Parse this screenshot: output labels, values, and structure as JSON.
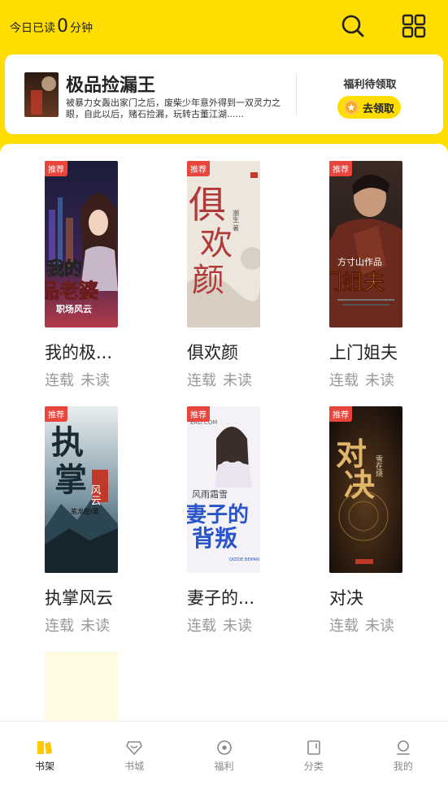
{
  "header": {
    "read_prefix": "今日已读",
    "read_minutes": "0",
    "read_suffix": "分钟"
  },
  "promo": {
    "title": "极品捡漏王",
    "description": "被暴力女轰出家门之后，废柴少年意外得到一双灵力之眼，自此以后，赌石捡漏，玩转古董江湖......",
    "reward_label": "福利待领取",
    "claim_button": "去领取"
  },
  "books": [
    {
      "title": "我的极...",
      "status": "连载",
      "read_state": "未读",
      "tag": "推荐"
    },
    {
      "title": "俱欢颜",
      "status": "连载",
      "read_state": "未读",
      "tag": "推荐"
    },
    {
      "title": "上门姐夫",
      "status": "连载",
      "read_state": "未读",
      "tag": "推荐"
    },
    {
      "title": "执掌风云",
      "status": "连载",
      "read_state": "未读",
      "tag": "推荐"
    },
    {
      "title": "妻子的...",
      "status": "连载",
      "read_state": "未读",
      "tag": "推荐"
    },
    {
      "title": "对决",
      "status": "连载",
      "read_state": "未读",
      "tag": "推荐"
    }
  ],
  "covers": {
    "b1_line1": "我的",
    "b1_line2": "品老婆",
    "b1_sub": "职场风云",
    "b2_big1": "俱",
    "b2_big2": "欢",
    "b2_big3": "颜",
    "b2_author": "潮生 著",
    "b3_author": "方寸山作品",
    "b3_big": "门姐夫",
    "b4_big1": "执",
    "b4_big2": "掌",
    "b4_side": "风云",
    "b4_author": "笔龙胆/著",
    "b5_site": "EAD.COM",
    "b5_author": "风雨霜雪",
    "b5_big1": "妻子的",
    "b5_big2": "背叛",
    "b5_pinyin": "QIZIDE BEIPAN",
    "b6_big1": "对",
    "b6_big2": "决",
    "b6_author": "雪在烧"
  },
  "tabs": [
    {
      "label": "书架",
      "icon": "bookshelf-icon",
      "active": true
    },
    {
      "label": "书城",
      "icon": "store-icon",
      "active": false
    },
    {
      "label": "福利",
      "icon": "welfare-icon",
      "active": false
    },
    {
      "label": "分类",
      "icon": "category-icon",
      "active": false
    },
    {
      "label": "我的",
      "icon": "profile-icon",
      "active": false
    }
  ],
  "colors": {
    "brand_yellow": "#FFDD00",
    "tag_red": "#E8453C",
    "coin_orange": "#F5A623",
    "text_muted": "#999999"
  }
}
